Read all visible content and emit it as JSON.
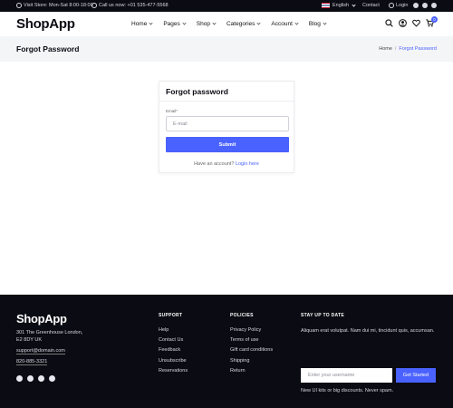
{
  "topbar": {
    "visit": "Visit Store: Mon-Sat 8:00-18:00",
    "call": "Call us now: +01 535-477-5568",
    "language": "English",
    "contact": "Contact",
    "login": "Login"
  },
  "header": {
    "logo": "ShopApp",
    "nav": [
      "Home",
      "Pages",
      "Shop",
      "Categories",
      "Account",
      "Blog"
    ],
    "cart_count": "0"
  },
  "page": {
    "title": "Forgot Password",
    "breadcrumb": {
      "home": "Home",
      "separator": "/",
      "current": "Forgot Password"
    }
  },
  "form": {
    "heading": "Forgot password",
    "email_label": "Email*",
    "email_placeholder": "E-mail",
    "submit_label": "Submit",
    "account_prompt": "Have an account?",
    "login_link": "Login here"
  },
  "footer": {
    "logo": "ShopApp",
    "address_line1": "301 The Greenhouse London,",
    "address_line2": "E2 8DY UK",
    "email": "support@domain.com",
    "phone": "820-885-3321",
    "support": {
      "title": "SUPPORT",
      "links": [
        "Help",
        "Contact Us",
        "Feedback",
        "Unsubscribe",
        "Reservations"
      ]
    },
    "policies": {
      "title": "POLICIES",
      "links": [
        "Privacy Policy",
        "Terms of use",
        "Gift card conditions",
        "Shipping",
        "Return"
      ]
    },
    "subscribe": {
      "title": "STAY UP TO DATE",
      "text": "Aliquam erat volutpat. Nam dui mi, tincidunt quis, accumsan.",
      "placeholder": "Enter your username",
      "button": "Get Started",
      "note": "New UI kits or big discounts. Never spam."
    }
  },
  "colors": {
    "accent": "#4a62ff",
    "dark": "#0b0b13",
    "band": "#f4f5f7"
  }
}
